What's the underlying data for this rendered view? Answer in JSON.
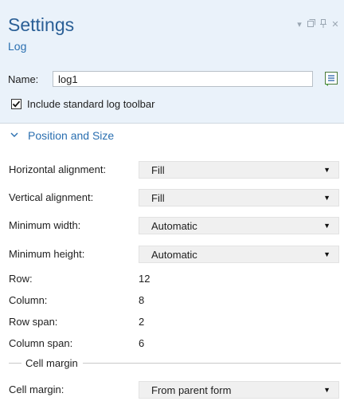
{
  "header": {
    "title": "Settings",
    "subtitle": "Log",
    "icons": [
      "dropdown-icon",
      "float-window-icon",
      "pin-icon",
      "close-icon"
    ]
  },
  "name": {
    "label": "Name:",
    "value": "log1",
    "button_icon": "edit-label-icon"
  },
  "include_toolbar": {
    "label": "Include standard log toolbar",
    "checked": true
  },
  "section": {
    "title": "Position and Size",
    "expanded": true
  },
  "fields": {
    "horizontal_alignment": {
      "label": "Horizontal alignment:",
      "value": "Fill"
    },
    "vertical_alignment": {
      "label": "Vertical alignment:",
      "value": "Fill"
    },
    "minimum_width": {
      "label": "Minimum width:",
      "value": "Automatic"
    },
    "minimum_height": {
      "label": "Minimum height:",
      "value": "Automatic"
    },
    "row": {
      "label": "Row:",
      "value": "12"
    },
    "column": {
      "label": "Column:",
      "value": "8"
    },
    "row_span": {
      "label": "Row span:",
      "value": "2"
    },
    "column_span": {
      "label": "Column span:",
      "value": "6"
    }
  },
  "cell_margin_group": {
    "legend": "Cell margin",
    "label": "Cell margin:",
    "value": "From parent form"
  }
}
